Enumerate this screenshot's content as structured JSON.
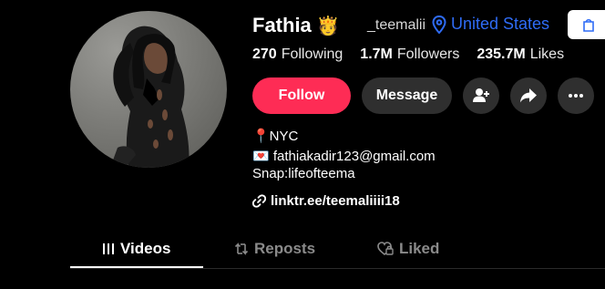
{
  "profile": {
    "display_name": "Fathia",
    "name_emoji": "🫅",
    "username": "_teemalii",
    "location": "United States",
    "avatar_icon": "profile-photo"
  },
  "stats": {
    "following_count": "270",
    "following_label": "Following",
    "followers_count": "1.7M",
    "followers_label": "Followers",
    "likes_count": "235.7M",
    "likes_label": "Likes"
  },
  "actions": {
    "follow_label": "Follow",
    "message_label": "Message",
    "icons": [
      "add-friend-icon",
      "share-icon",
      "more-icon"
    ]
  },
  "bio": {
    "line1": "📍NYC",
    "line2": "💌  fathiakadir123@gmail.com",
    "line3": "Snap:lifeofteema",
    "link": "linktr.ee/teemaliiii18"
  },
  "tabs": [
    {
      "label": "Videos",
      "icon": "videos-grid-icon",
      "active": true
    },
    {
      "label": "Reposts",
      "icon": "repost-icon",
      "active": false
    },
    {
      "label": "Liked",
      "icon": "liked-icon",
      "active": false
    }
  ],
  "colors": {
    "accent": "#fe2c55",
    "location": "#2f6cf6",
    "background": "#000000",
    "button_secondary": "#2f2f2f"
  }
}
